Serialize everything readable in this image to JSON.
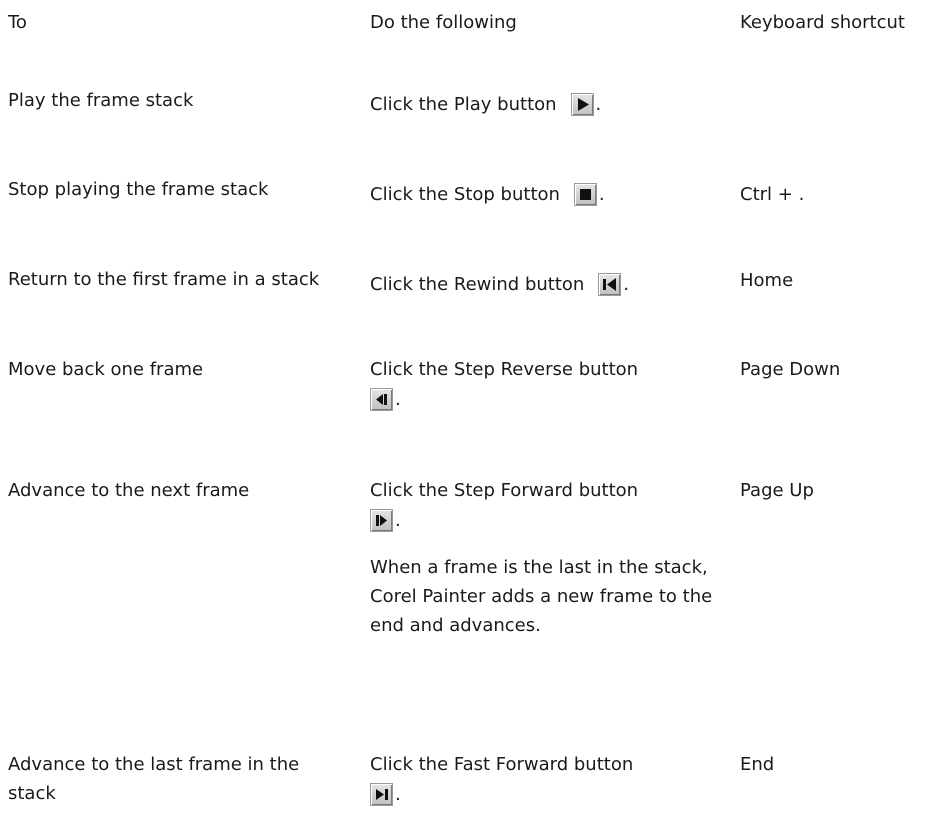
{
  "headers": {
    "to": "To",
    "do": "Do the following",
    "shortcut": "Keyboard shortcut"
  },
  "rows": [
    {
      "to": "Play the frame stack",
      "pre": "Click the",
      "bold": "Play",
      "post": "button",
      "icon": "play-icon",
      "shortcut": ""
    },
    {
      "to": "Stop playing the frame stack",
      "pre": "Click the",
      "bold": "Stop",
      "post": "button",
      "icon": "stop-icon",
      "shortcut_key": "Ctrl",
      "shortcut_plus": "+",
      "shortcut_rest": "."
    },
    {
      "to": "Return to the first frame in a stack",
      "pre": "Click the",
      "bold": "Rewind",
      "post": "button",
      "icon": "rewind-icon",
      "shortcut": "Home"
    },
    {
      "to": "Move back one frame",
      "pre": "Click the",
      "bold": "Step Reverse",
      "post": "button",
      "icon": "step-reverse-icon",
      "shortcut": "Page Down"
    },
    {
      "to": "Advance to the next frame",
      "pre": "Click the",
      "bold": "Step Forward",
      "post": "button",
      "icon": "step-forward-icon",
      "shortcut": "Page Up",
      "note": "When a frame is the last in the stack, Corel Painter adds a new frame to the end and advances."
    },
    {
      "to": "Advance to the last frame in the stack",
      "pre": "Click the Fast Forward button",
      "icon": "fast-forward-icon",
      "shortcut": "End"
    }
  ]
}
